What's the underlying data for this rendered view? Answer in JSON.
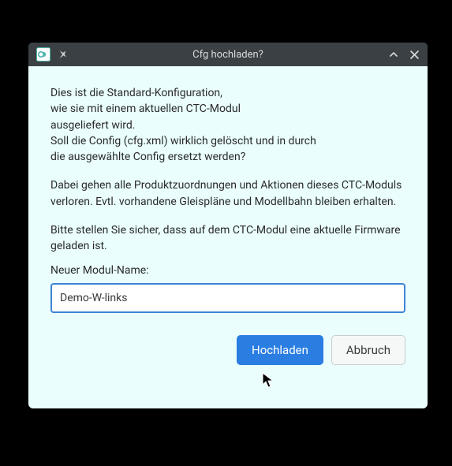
{
  "window": {
    "title": "Cfg hochladen?"
  },
  "body": {
    "p1": "Dies ist die Standard-Konfiguration,\nwie sie mit einem aktuellen CTC-Modul\nausgeliefert wird.\nSoll die Config (cfg.xml) wirklich gelöscht und in durch\ndie ausgewählte Config ersetzt werden?",
    "p2": "Dabei gehen alle Produktzuordnungen und Aktionen dieses CTC-Moduls verloren. Evtl. vorhandene Gleispläne und Modellbahn bleiben erhalten.",
    "p3": "Bitte stellen Sie sicher, dass auf dem CTC-Modul eine aktuelle Firmware geladen ist."
  },
  "form": {
    "label": "Neuer Modul-Name:",
    "value": "Demo-W-links"
  },
  "buttons": {
    "primary": "Hochladen",
    "secondary": "Abbruch"
  },
  "icons": {
    "app": "app-icon",
    "pin": "pin-icon",
    "minimize": "chevron-up-icon",
    "close": "close-icon"
  },
  "colors": {
    "titlebar_bg": "#3a4043",
    "dialog_bg": "#eafefe",
    "primary": "#2a7de1",
    "input_border": "#3e84d6"
  }
}
